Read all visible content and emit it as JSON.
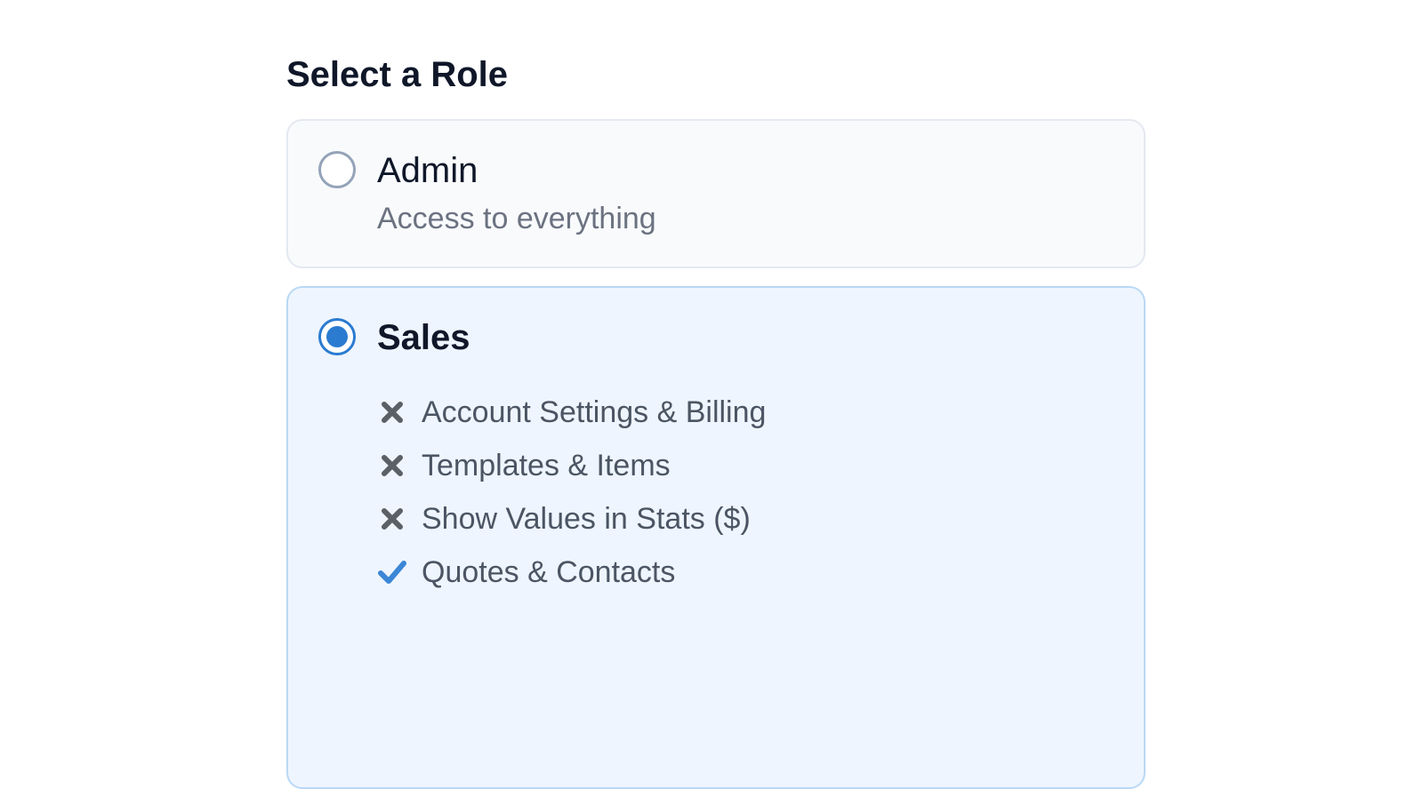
{
  "heading": "Select a Role",
  "roles": [
    {
      "name": "Admin",
      "description": "Access to everything",
      "selected": false
    },
    {
      "name": "Sales",
      "selected": true,
      "permissions": [
        {
          "label": "Account Settings & Billing",
          "allowed": false,
          "icon": "x-icon"
        },
        {
          "label": "Templates & Items",
          "allowed": false,
          "icon": "x-icon"
        },
        {
          "label": "Show Values in Stats ($)",
          "allowed": false,
          "icon": "x-icon"
        },
        {
          "label": "Quotes & Contacts",
          "allowed": true,
          "icon": "check-icon"
        }
      ]
    }
  ],
  "colors": {
    "accent": "#2b7bd0",
    "check": "#3b86d6",
    "cross": "#5b6067"
  }
}
